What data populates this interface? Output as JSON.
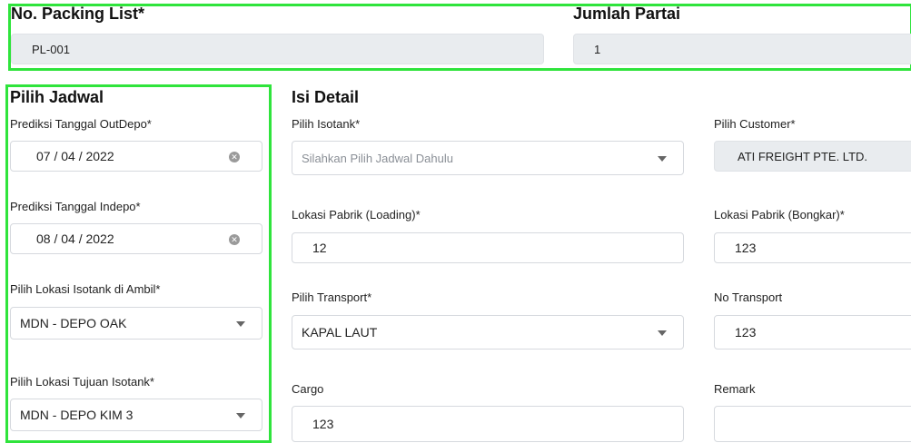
{
  "header": {
    "packing_list_label": "No. Packing List*",
    "packing_list_value": "PL-001",
    "jumlah_partai_label": "Jumlah Partai",
    "jumlah_partai_value": "1"
  },
  "jadwal": {
    "title": "Pilih Jadwal",
    "outdepo_label": "Prediksi Tanggal OutDepo*",
    "outdepo_value": "07 / 04 / 2022",
    "indepo_label": "Prediksi Tanggal Indepo*",
    "indepo_value": "08 / 04 / 2022",
    "ambil_label": "Pilih Lokasi Isotank di Ambil*",
    "ambil_value": "MDN - DEPO OAK",
    "tujuan_label": "Pilih Lokasi Tujuan Isotank*",
    "tujuan_value": "MDN - DEPO KIM 3"
  },
  "detail": {
    "title": "Isi Detail",
    "isotank_label": "Pilih Isotank*",
    "isotank_placeholder": "Silahkan Pilih Jadwal Dahulu",
    "customer_label": "Pilih Customer*",
    "customer_value": "ATI FREIGHT PTE. LTD.",
    "loading_label": "Lokasi Pabrik (Loading)*",
    "loading_value": "12",
    "bongkar_label": "Lokasi Pabrik (Bongkar)*",
    "bongkar_value": "123",
    "transport_label": "Pilih Transport*",
    "transport_value": "KAPAL LAUT",
    "no_transport_label": "No Transport",
    "no_transport_value": "123",
    "cargo_label": "Cargo",
    "cargo_value": "123",
    "remark_label": "Remark",
    "remark_value": ""
  },
  "colors": {
    "highlight": "#2fe43c",
    "readonly_bg": "#e9ecef"
  }
}
